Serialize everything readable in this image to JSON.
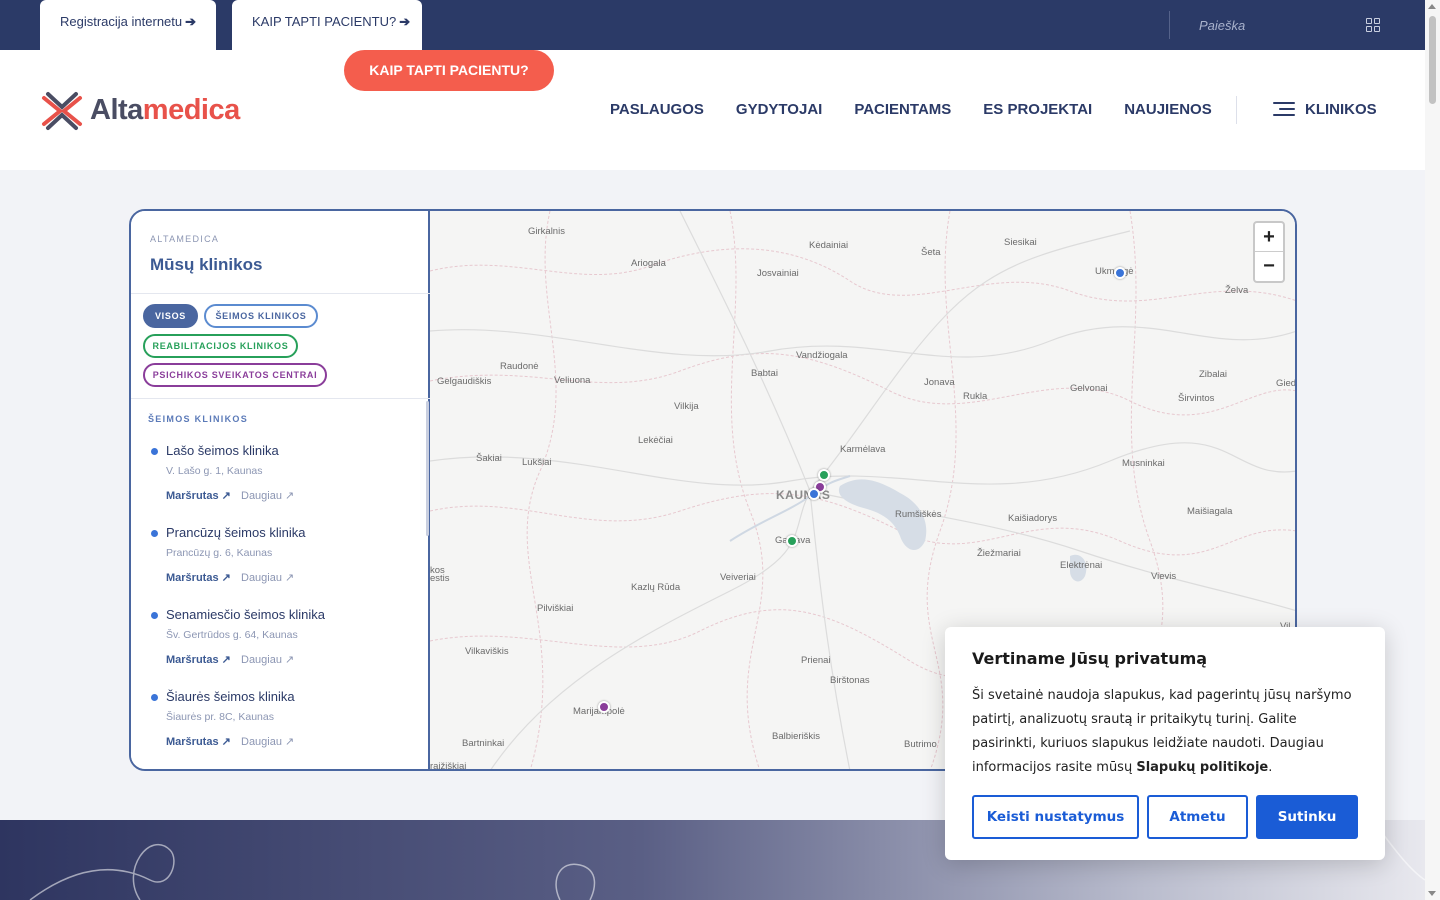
{
  "topbar": {
    "tab_register": "Registracija internetu",
    "tab_become": "KAIP TAPTI PACIENTU?",
    "search_placeholder": "Paieška"
  },
  "header": {
    "logo_part1": "Alta",
    "logo_part2": "medica",
    "cta": "KAIP TAPTI PACIENTU?",
    "nav": [
      "PASLAUGOS",
      "GYDYTOJAI",
      "PACIENTAMS",
      "ES PROJEKTAI",
      "NAUJIENOS"
    ],
    "clinics_label": "KLINIKOS"
  },
  "panel": {
    "eyebrow": "ALTAMEDICA",
    "title": "Mūsų klinikos",
    "filters": {
      "all": "VISOS",
      "family": "ŠEIMOS KLINIKOS",
      "rehab": "REABILITACIJOS KLINIKOS",
      "mental": "PSICHIKOS SVEIKATOS CENTRAI"
    },
    "section_label": "ŠEIMOS KLINIKOS",
    "clinics": [
      {
        "name": "Lašo šeimos klinika",
        "address": "V. Lašo g. 1, Kaunas",
        "route": "Maršrutas ↗",
        "more": "Daugiau ↗"
      },
      {
        "name": "Prancūzų šeimos klinika",
        "address": "Prancūzų g. 6, Kaunas",
        "route": "Maršrutas ↗",
        "more": "Daugiau ↗"
      },
      {
        "name": "Senamiesčio šeimos klinika",
        "address": "Šv. Gertrūdos g. 64, Kaunas",
        "route": "Maršrutas ↗",
        "more": "Daugiau ↗"
      },
      {
        "name": "Šiaurės šeimos klinika",
        "address": "Šiaurės pr. 8C, Kaunas",
        "route": "Maršrutas ↗",
        "more": "Daugiau ↗"
      }
    ]
  },
  "map": {
    "zoom_in": "+",
    "zoom_out": "−",
    "places": {
      "girkalnis": "Girkalnis",
      "kedainiai": "Kėdainiai",
      "seta": "Šeta",
      "siesikai": "Siesikai",
      "ukmerge": "Ukmergė",
      "zelva": "Želva",
      "ariogala": "Ariogala",
      "josvainiai": "Josvainiai",
      "vandziogala": "Vandžiogala",
      "raudone": "Raudonė",
      "veliuona": "Veliuona",
      "babtai": "Babtai",
      "jonava": "Jonava",
      "rukla": "Rukla",
      "gelvonai": "Gelvonai",
      "zibalai": "Zibalai",
      "sirvintos": "Širvintos",
      "gied": "Gied",
      "gelgaudiskis": "Gelgaudiškis",
      "vilkija": "Vilkija",
      "lekeciai": "Lekėčiai",
      "sakiai": "Šakiai",
      "luksiai": "Lukšiai",
      "karmelava": "Karmėlava",
      "musninkai": "Musninkai",
      "kaunas": "KAUNAS",
      "rumsiskes": "Rumšiškės",
      "kaisiadorys": "Kaišiadorys",
      "maisiagala": "Maišiagala",
      "garliava": "Garliava",
      "kazlu_ruda": "Kazlų Rūda",
      "veiveriai": "Veiveriai",
      "ziezmariai": "Žiežmariai",
      "elektrenai": "Elektrėnai",
      "vievis": "Vievis",
      "kos": "kos",
      "estis": "estis",
      "pilviskiai": "Pilviškiai",
      "vilkaviskis": "Vilkaviškis",
      "prienai": "Prienai",
      "birstonas": "Birštonas",
      "marijampole": "Marijampolė",
      "bartninkai": "Bartninkai",
      "balbieriskis": "Balbieriškis",
      "butrimonys": "Butrimo",
      "kalvarija": "raižiškiai",
      "vil": "Vil"
    },
    "marker_colors": {
      "family": "#3a74d8",
      "rehab": "#27a05a",
      "mental": "#8a3d9a"
    }
  },
  "cookie": {
    "title": "Vertiname Jūsų privatumą",
    "text": "Ši svetainė naudoja slapukus, kad pagerintų jūsų naršymo patirtį, analizuotų srautą ir pritaikytų turinį. Galite pasirinkti, kuriuos slapukus leidžiate naudoti. Daugiau informacijos rasite mūsų",
    "policy_link": "Slapukų politikoje",
    "text_end": ".",
    "btn_settings": "Keisti nustatymus",
    "btn_reject": "Atmetu",
    "btn_accept": "Sutinku"
  },
  "colors": {
    "navy": "#2b3a67",
    "accent_red": "#f45d4d",
    "cookie_blue": "#1a5cd6"
  }
}
